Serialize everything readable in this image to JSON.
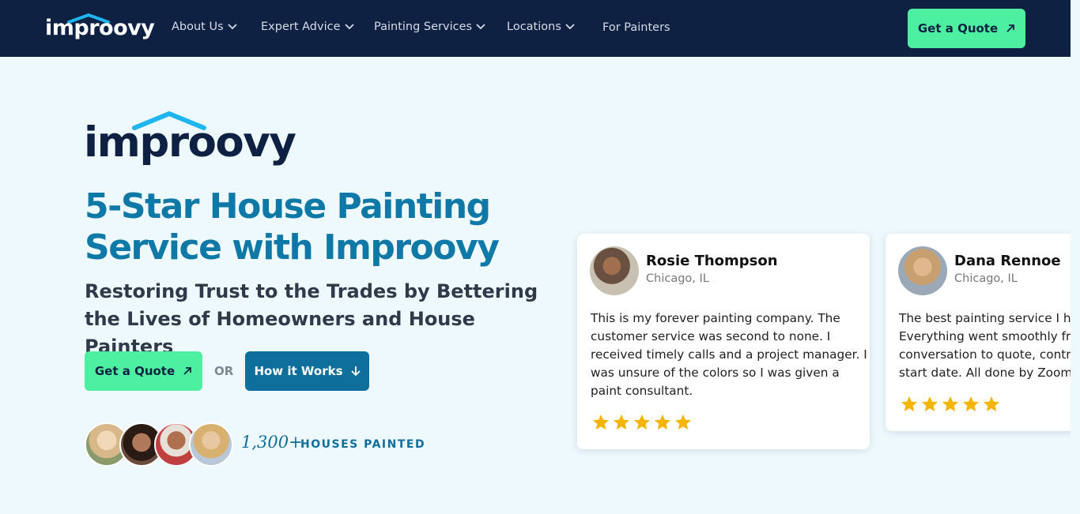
{
  "nav": {
    "brand": "improovy",
    "items": [
      {
        "label": "About Us",
        "dropdown": true
      },
      {
        "label": "Expert Advice",
        "dropdown": true
      },
      {
        "label": "Painting Services",
        "dropdown": true
      },
      {
        "label": "Locations",
        "dropdown": true
      },
      {
        "label": "For Painters",
        "dropdown": false
      }
    ],
    "cta_label": "Get a Quote"
  },
  "hero": {
    "brand": "improovy",
    "headline": "5-Star House Painting Service with Improovy",
    "subheadline": "Restoring Trust to the Trades by Bettering the Lives of Homeowners and House Painters",
    "quote_button": "Get a Quote",
    "or_text": "OR",
    "how_button": "How it Works",
    "houses_count": "1,300+",
    "houses_label": "HOUSES PAINTED"
  },
  "reviews": [
    {
      "name": "Rosie Thompson",
      "location": "Chicago, IL",
      "text": "This is my forever painting company. The\ncustomer service was second to none. I\nreceived timely calls and a project manager. I\nwas unsure of the colors so I was given a\npaint consultant.",
      "rating": 5
    },
    {
      "name": "Dana Rennoe",
      "location": "Chicago, IL",
      "text": "The best painting service I ha\n Everything went smoothly fro\nconversation to quote, contra\nstart date. All done by Zoom, t",
      "rating": 5
    }
  ],
  "colors": {
    "nav_bg": "#0f2142",
    "accent_green": "#4df0a0",
    "brand_blue": "#0e78a6",
    "page_bg": "#edf9fd",
    "star": "#f5b400"
  }
}
